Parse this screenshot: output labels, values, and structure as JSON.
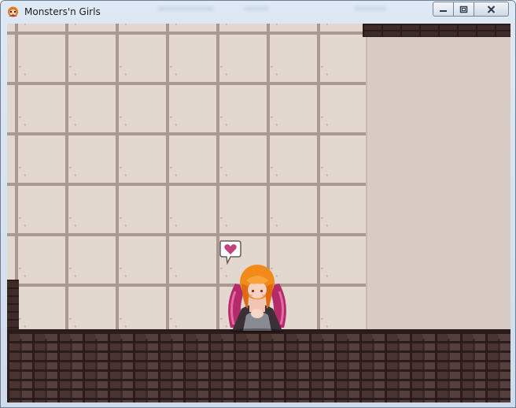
{
  "window": {
    "title": "Monsters'n Girls",
    "controls": {
      "minimize_icon": "minimize-icon",
      "maximize_icon": "restore-icon",
      "close_icon": "close-icon"
    }
  },
  "scene": {
    "wall_color": "#e3d8d0",
    "grout_color": "#aa9893",
    "brick_color": "#4a3331",
    "emote": "heart-icon",
    "emote_color": "#c0447a",
    "character": "winged-girl-sprite",
    "hair_color": "#f28a1a",
    "wing_color": "#b52a6b"
  }
}
